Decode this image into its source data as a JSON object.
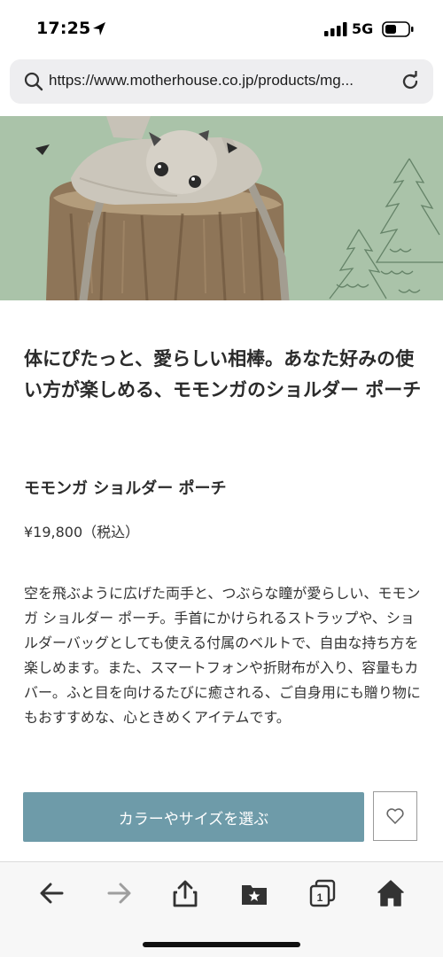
{
  "status_bar": {
    "time": "17:25",
    "network": "5G"
  },
  "browser": {
    "url": "https://www.motherhouse.co.jp/products/mg...",
    "tab_count": "1"
  },
  "product": {
    "headline": "体にぴたっと、愛らしい相棒。あなた好みの使い方が楽しめる、モモンガのショルダー ポーチ",
    "name": "モモンガ ショルダー ポーチ",
    "price": "¥19,800（税込）",
    "description": "空を飛ぶように広げた両手と、つぶらな瞳が愛らしい、モモンガ ショルダー ポーチ。手首にかけられるストラップや、ショルダーバッグとしても使える付属のベルトで、自由な持ち方を楽しめます。また、スマートフォンや折財布が入り、容量もカバー。ふと目を向けるたびに癒される、ご自身用にも贈り物にもおすすめな、心ときめくアイテムです。",
    "cta_label": "カラーやサイズを選ぶ"
  },
  "icons": {
    "location": "location-arrow-icon",
    "signal": "signal-bars-icon",
    "battery": "battery-icon",
    "search": "search-icon",
    "reload": "reload-icon",
    "favorite": "heart-icon",
    "back": "back-arrow-icon",
    "forward": "forward-arrow-icon",
    "share": "share-icon",
    "bookmarks": "bookmarks-icon",
    "tabs": "tabs-icon",
    "home": "home-icon"
  },
  "colors": {
    "cta_background": "#6e9ba9",
    "hero_background": "#a3bea4",
    "toolbar_disabled": "#9e9e9e"
  }
}
